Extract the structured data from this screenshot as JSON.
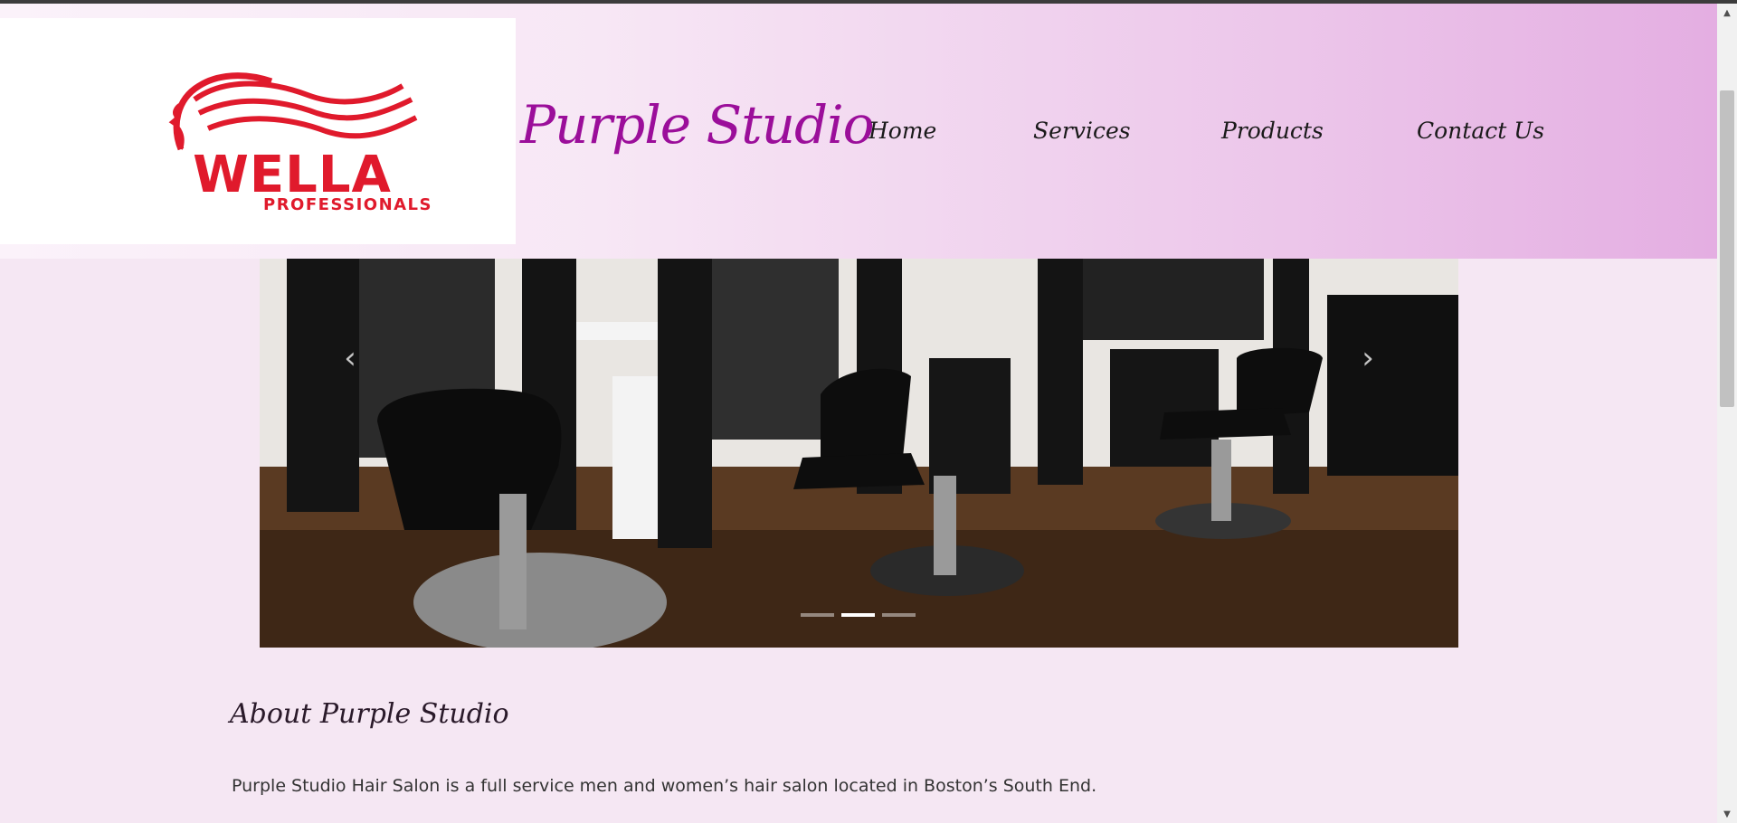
{
  "logo": {
    "name": "WELLA",
    "sub": "PROFESSIONALS",
    "color": "#e01a2c"
  },
  "brand": {
    "title": "Purple Studio",
    "color": "#9b0e9a"
  },
  "nav": {
    "home": "Home",
    "services": "Services",
    "products": "Products",
    "contact": "Contact Us"
  },
  "carousel": {
    "prev": "‹",
    "next": "›",
    "slide_count": 3,
    "active_slide": 2
  },
  "about": {
    "title": "About Purple Studio",
    "text": "Purple Studio Hair Salon is a full service men and women’s hair salon located in Boston’s South End."
  },
  "scrollbar": {
    "up": "▲",
    "down": "▼"
  }
}
